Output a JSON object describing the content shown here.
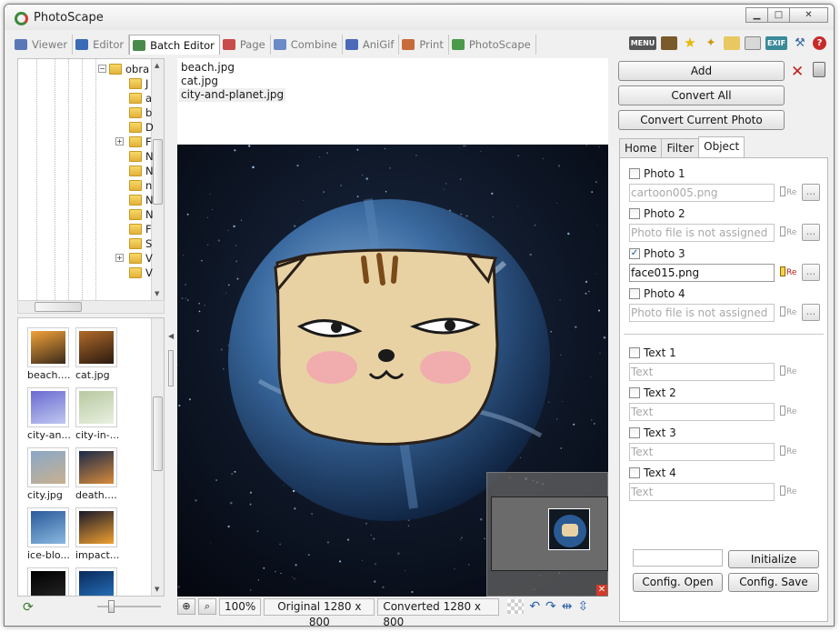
{
  "window": {
    "title": "PhotoScape",
    "minimize": "▁",
    "maximize": "□",
    "close": "✕"
  },
  "nav": {
    "tabs": [
      {
        "label": "Viewer",
        "color": "#5a78b8"
      },
      {
        "label": "Editor",
        "color": "#3a6ab8"
      },
      {
        "label": "Batch Editor",
        "color": "#4a8a4a",
        "active": true
      },
      {
        "label": "Page",
        "color": "#c84a4a"
      },
      {
        "label": "Combine",
        "color": "#6a8ac8"
      },
      {
        "label": "AniGif",
        "color": "#4a6ab8"
      },
      {
        "label": "Print",
        "color": "#c86a3a"
      },
      {
        "label": "PhotoScape",
        "color": "#4a9a4a"
      }
    ],
    "menu_label": "MENU",
    "exif_label": "EXIF",
    "help_label": "?"
  },
  "tree": {
    "root_label": "obra",
    "items": [
      "J",
      "a",
      "b",
      "D",
      "F",
      "N",
      "N",
      "n",
      "N",
      "N",
      "F",
      "S",
      "V",
      "V"
    ]
  },
  "thumbnails": [
    {
      "label": "beach....",
      "c1": "#f2a23a",
      "c2": "#3a2a1a"
    },
    {
      "label": "cat.jpg",
      "c1": "#b06a2a",
      "c2": "#2a1a10"
    },
    {
      "label": "city-an...",
      "c1": "#6a6ad0",
      "c2": "#c0c8f0"
    },
    {
      "label": "city-in-...",
      "c1": "#b8c8a0",
      "c2": "#e8f0e0"
    },
    {
      "label": "city.jpg",
      "c1": "#8aa8c8",
      "c2": "#c8b090"
    },
    {
      "label": "death....",
      "c1": "#1a2a4a",
      "c2": "#d88a3a"
    },
    {
      "label": "ice-blo...",
      "c1": "#2a5a9a",
      "c2": "#8ab8e0"
    },
    {
      "label": "impact...",
      "c1": "#1a1a2a",
      "c2": "#f0a030"
    },
    {
      "label": "",
      "c1": "#000000",
      "c2": "#2a2a2a"
    },
    {
      "label": "",
      "c1": "#0a2a5a",
      "c2": "#2a7ac8"
    }
  ],
  "files": {
    "items": [
      {
        "name": "beach.jpg"
      },
      {
        "name": "cat.jpg"
      },
      {
        "name": "city-and-planet.jpg",
        "selected": true
      }
    ]
  },
  "navigator": {
    "close_label": "✕"
  },
  "status": {
    "zoom": "100%",
    "original": "Original 1280 x 800",
    "converted": "Converted 1280 x 800"
  },
  "right": {
    "add_label": "Add",
    "convert_all_label": "Convert All",
    "convert_current_label": "Convert Current Photo",
    "tabs": [
      "Home",
      "Filter",
      "Object"
    ],
    "active_tab": "Object",
    "photos": [
      {
        "label": "Photo 1",
        "checked": false,
        "value": "cartoon005.png",
        "active": false
      },
      {
        "label": "Photo 2",
        "checked": false,
        "value": "Photo file is not assigned",
        "active": false
      },
      {
        "label": "Photo 3",
        "checked": true,
        "value": "face015.png",
        "active": true
      },
      {
        "label": "Photo 4",
        "checked": false,
        "value": "Photo file is not assigned",
        "active": false
      }
    ],
    "texts": [
      {
        "label": "Text 1",
        "placeholder": "Text"
      },
      {
        "label": "Text 2",
        "placeholder": "Text"
      },
      {
        "label": "Text 3",
        "placeholder": "Text"
      },
      {
        "label": "Text 4",
        "placeholder": "Text"
      }
    ],
    "re_label": "Re",
    "dots_label": "...",
    "initialize_label": "Initialize",
    "config_open_label": "Config. Open",
    "config_save_label": "Config. Save"
  }
}
